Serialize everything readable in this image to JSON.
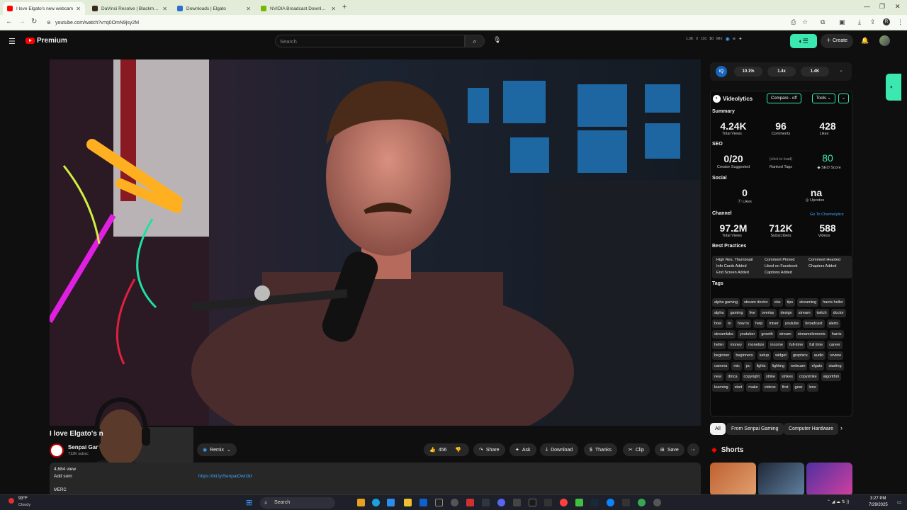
{
  "browser": {
    "tabs": [
      {
        "title": "I love Elgato's new webcam",
        "active": true,
        "favicon_color": "#ff0000"
      },
      {
        "title": "DaVinci Resolve | Blackmagic D",
        "active": false,
        "favicon_color": "#3a2a1a"
      },
      {
        "title": "Downloads | Elgato",
        "active": false,
        "favicon_color": "#2c6fd1"
      },
      {
        "title": "NVIDIA Broadcast Download & ",
        "active": false,
        "favicon_color": "#76b900"
      }
    ],
    "url": "youtube.com/watch?v=q0OmN9jsy2M"
  },
  "youtube": {
    "logo_text": "Premium",
    "search_placeholder": "Search",
    "header_stats": [
      "1.3K",
      "0",
      "101",
      "$0",
      "Mhr"
    ],
    "create_label": "Create"
  },
  "video": {
    "title": "I love Elgato's n",
    "channel_name": "Senpai Gar",
    "channel_subs": "712K subsc",
    "remix_label": "Remix",
    "likes": "456",
    "share_label": "Share",
    "ask_label": "Ask",
    "download_label": "Download",
    "thanks_label": "Thanks",
    "clip_label": "Clip",
    "save_label": "Save",
    "views_text": "4,684 view",
    "add_text": "Add som",
    "desc_link": "https://bit.ly/SenpaiOwn3d",
    "merch_text": "MERC"
  },
  "widget_top": {
    "pill1": "10.1%",
    "pill2": "1.4x",
    "pill3": "1.4K"
  },
  "videolytics": {
    "brand": "Videolytics",
    "compare_label": "Compare - off",
    "tools_label": "Tools",
    "summary_heading": "Summary",
    "summary": [
      {
        "value": "4.24K",
        "label": "Total Views"
      },
      {
        "value": "96",
        "label": "Comments"
      },
      {
        "value": "428",
        "label": "Likes"
      }
    ],
    "seo_heading": "SEO",
    "seo": {
      "creator_value": "0/20",
      "creator_label": "Creator Suggested",
      "ranked_note": "(click to load)",
      "ranked_label": "Ranked Tags",
      "score_value": "80",
      "score_label": "SEO Score"
    },
    "social_heading": "Social",
    "social": [
      {
        "value": "0",
        "label": "Likes"
      },
      {
        "value": "na",
        "label": "Upvotes"
      }
    ],
    "channel_heading": "Channel",
    "channel_link": "Go To Channelytics",
    "channel": [
      {
        "value": "97.2M",
        "label": "Total Views"
      },
      {
        "value": "712K",
        "label": "Subscribers"
      },
      {
        "value": "588",
        "label": "Videos"
      }
    ],
    "bp_heading": "Best Practices",
    "best_practices": [
      "High Res. Thumbnail",
      "Comment Pinned",
      "Comment Hearted",
      "Info Cards Added",
      "Liked on Facebook",
      "Chapters Added",
      "End Screen Added",
      "Captions Added"
    ],
    "tags_heading": "Tags",
    "tags": [
      "alpha gaming",
      "stream doctor",
      "obs",
      "tips",
      "streaming",
      "harris heller",
      "alpha",
      "gaming",
      "live",
      "overlay",
      "design",
      "stream",
      "twitch",
      "doctor",
      "how",
      "to",
      "how to",
      "help",
      "mixer",
      "youtube",
      "broadcast",
      "alerts",
      "streamlabs",
      "youtuber",
      "growth",
      "stream",
      "streamelements",
      "harris",
      "heller",
      "money",
      "monetize",
      "income",
      "full-time",
      "full time",
      "career",
      "beginner",
      "beginners",
      "setup",
      "widget",
      "graphics",
      "audio",
      "review",
      "camera",
      "mic",
      "pc",
      "lights",
      "lighting",
      "webcam",
      "elgato",
      "starting",
      "new",
      "dmca",
      "copyright",
      "strike",
      "strikes",
      "copystrike",
      "algorithm",
      "learning",
      "start",
      "make",
      "videos",
      "first",
      "gear",
      "lens"
    ]
  },
  "chips": [
    "All",
    "From Senpai Gaming",
    "Computer Hardware"
  ],
  "shorts_label": "Shorts",
  "taskbar": {
    "weather_temp": "93°F",
    "weather_desc": "Cloudy",
    "search_label": "Search",
    "time": "3:27 PM",
    "date": "7/29/2025"
  }
}
